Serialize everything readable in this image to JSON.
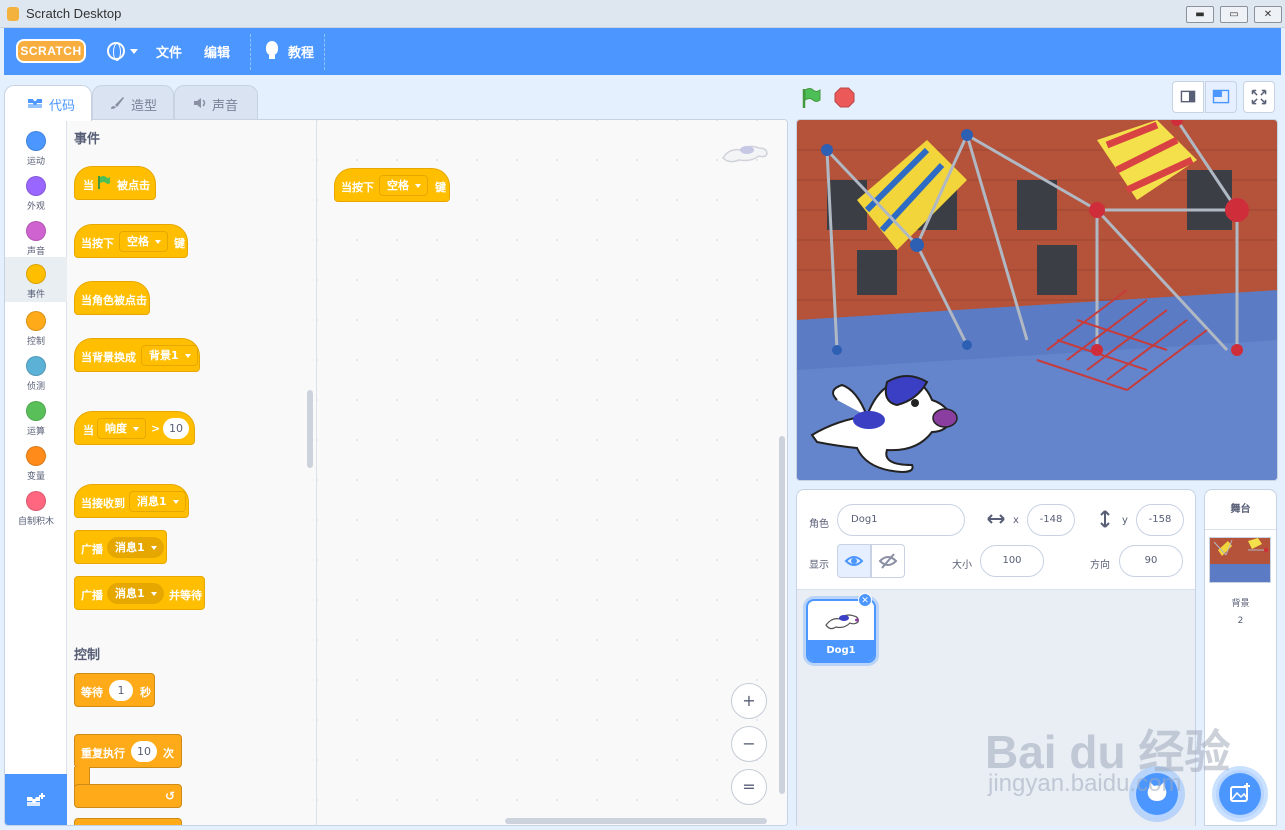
{
  "window": {
    "title": "Scratch Desktop",
    "min": "▬",
    "max": "▭",
    "close": "✕"
  },
  "menubar": {
    "logo": "SCRATCH",
    "file": "文件",
    "edit": "编辑",
    "tutorials": "教程"
  },
  "tabs": [
    {
      "label": "代码"
    },
    {
      "label": "造型"
    },
    {
      "label": "声音"
    }
  ],
  "categories": [
    {
      "label": "运动",
      "color": "#4c97ff"
    },
    {
      "label": "外观",
      "color": "#9966ff"
    },
    {
      "label": "声音",
      "color": "#cf63cf"
    },
    {
      "label": "事件",
      "color": "#ffbf00"
    },
    {
      "label": "控制",
      "color": "#ffab19"
    },
    {
      "label": "侦测",
      "color": "#5cb1d6"
    },
    {
      "label": "运算",
      "color": "#59c059"
    },
    {
      "label": "变量",
      "color": "#ff8c1a"
    },
    {
      "label": "自制积木",
      "color": "#ff6680"
    }
  ],
  "palette": {
    "events_title": "事件",
    "when_flag_a": "当",
    "when_flag_b": "被点击",
    "key_a": "当按下",
    "key_dropdown": "空格",
    "key_b": "键",
    "sprite_clicked": "当角色被点击",
    "backdrop_switch": "当背景换成",
    "backdrop_dropdown": "背景1",
    "loudness_a": "当",
    "loudness_dropdown": "响度",
    "loudness_gt": ">",
    "loudness_value": "10",
    "receive": "当接收到",
    "receive_dropdown": "消息1",
    "broadcast": "广播",
    "broadcast_dropdown": "消息1",
    "broadcast_wait": "广播",
    "broadcast_wait_dropdown": "消息1",
    "broadcast_wait_b": "并等待",
    "control_title": "控制",
    "wait_a": "等待",
    "wait_value": "1",
    "wait_b": "秒",
    "repeat_a": "重复执行",
    "repeat_value": "10",
    "repeat_b": "次",
    "repeat_arrow": "↺"
  },
  "workspace": {
    "block_a": "当按下",
    "block_dropdown": "空格",
    "block_b": "键",
    "zoom_in": "+",
    "zoom_out": "−",
    "zoom_reset": "="
  },
  "sprite_info": {
    "sprite_label": "角色",
    "sprite_name": "Dog1",
    "x_label": "x",
    "x_value": "-148",
    "y_label": "y",
    "y_value": "-158",
    "show_label": "显示",
    "size_label": "大小",
    "size_value": "100",
    "direction_label": "方向",
    "direction_value": "90"
  },
  "sprites": [
    {
      "name": "Dog1"
    }
  ],
  "stage_pane": {
    "title": "舞台",
    "backdrops_label": "背景",
    "backdrops_count": "2"
  },
  "watermark": {
    "line1": "Bai du 经验",
    "line2": "jingyan.baidu.com"
  }
}
